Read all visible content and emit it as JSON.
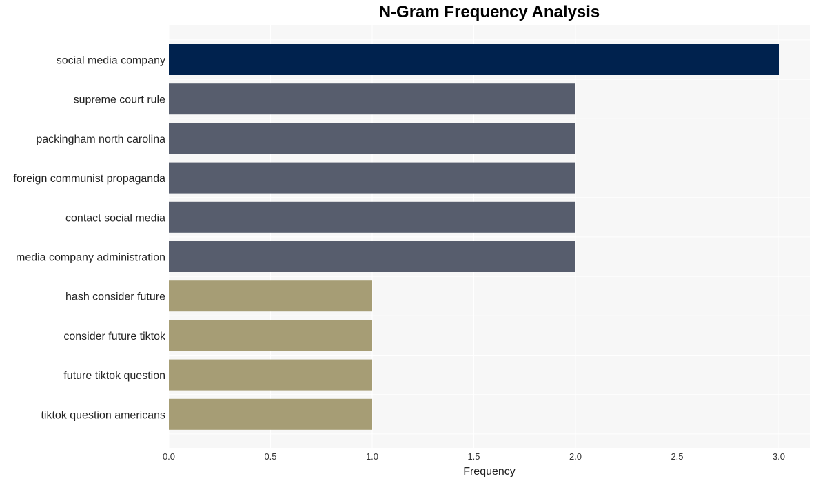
{
  "chart_data": {
    "type": "bar",
    "orientation": "horizontal",
    "title": "N-Gram Frequency Analysis",
    "xlabel": "Frequency",
    "ylabel": "",
    "xlim": [
      0,
      3.15
    ],
    "xticks": [
      "0.0",
      "0.5",
      "1.0",
      "1.5",
      "2.0",
      "2.5",
      "3.0"
    ],
    "xtick_values": [
      0,
      0.5,
      1.0,
      1.5,
      2.0,
      2.5,
      3.0
    ],
    "grid": true,
    "categories": [
      "social media company",
      "supreme court rule",
      "packingham north carolina",
      "foreign communist propaganda",
      "contact social media",
      "media company administration",
      "hash consider future",
      "consider future tiktok",
      "future tiktok question",
      "tiktok question americans"
    ],
    "values": [
      3,
      2,
      2,
      2,
      2,
      2,
      1,
      1,
      1,
      1
    ],
    "colors": [
      "#00224e",
      "#575d6d",
      "#575d6d",
      "#575d6d",
      "#575d6d",
      "#575d6d",
      "#a69d75",
      "#a69d75",
      "#a69d75",
      "#a69d75"
    ],
    "background": "#f7f7f7",
    "grid_color": "#ffffff"
  }
}
